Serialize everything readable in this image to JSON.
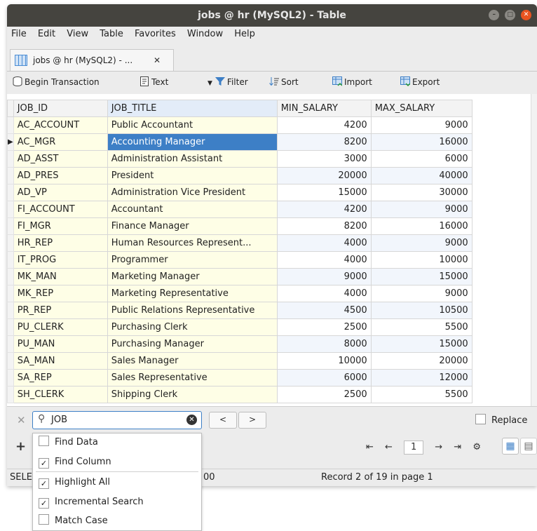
{
  "window": {
    "title": "jobs @ hr (MySQL2) - Table"
  },
  "menu": [
    "File",
    "Edit",
    "View",
    "Table",
    "Favorites",
    "Window",
    "Help"
  ],
  "doc_tab": {
    "label": "jobs @ hr (MySQL2) - ...",
    "close": "✕"
  },
  "toolbar": {
    "begin_transaction": "Begin Transaction",
    "text": "Text",
    "filter": "Filter",
    "sort": "Sort",
    "import": "Import",
    "export": "Export"
  },
  "table": {
    "columns": [
      "JOB_ID",
      "JOB_TITLE",
      "MIN_SALARY",
      "MAX_SALARY"
    ],
    "rows": [
      [
        "AC_ACCOUNT",
        "Public Accountant",
        "4200",
        "9000"
      ],
      [
        "AC_MGR",
        "Accounting Manager",
        "8200",
        "16000"
      ],
      [
        "AD_ASST",
        "Administration Assistant",
        "3000",
        "6000"
      ],
      [
        "AD_PRES",
        "President",
        "20000",
        "40000"
      ],
      [
        "AD_VP",
        "Administration Vice President",
        "15000",
        "30000"
      ],
      [
        "FI_ACCOUNT",
        "Accountant",
        "4200",
        "9000"
      ],
      [
        "FI_MGR",
        "Finance Manager",
        "8200",
        "16000"
      ],
      [
        "HR_REP",
        "Human Resources Represent...",
        "4000",
        "9000"
      ],
      [
        "IT_PROG",
        "Programmer",
        "4000",
        "10000"
      ],
      [
        "MK_MAN",
        "Marketing Manager",
        "9000",
        "15000"
      ],
      [
        "MK_REP",
        "Marketing Representative",
        "4000",
        "9000"
      ],
      [
        "PR_REP",
        "Public Relations Representative",
        "4500",
        "10500"
      ],
      [
        "PU_CLERK",
        "Purchasing Clerk",
        "2500",
        "5500"
      ],
      [
        "PU_MAN",
        "Purchasing Manager",
        "8000",
        "15000"
      ],
      [
        "SA_MAN",
        "Sales Manager",
        "10000",
        "20000"
      ],
      [
        "SA_REP",
        "Sales Representative",
        "6000",
        "12000"
      ],
      [
        "SH_CLERK",
        "Shipping Clerk",
        "2500",
        "5500"
      ]
    ],
    "selected_row_index": 1,
    "row_indicator": "▶"
  },
  "find": {
    "value": "JOB",
    "prev": "<",
    "next": ">",
    "replace_label": "Replace"
  },
  "find_options": [
    {
      "label": "Find Data",
      "checked": false
    },
    {
      "label": "Find Column",
      "checked": true
    },
    {
      "label": "Highlight All",
      "checked": true
    },
    {
      "label": "Incremental Search",
      "checked": true
    },
    {
      "label": "Match Case",
      "checked": false
    }
  ],
  "pager": {
    "page": "1"
  },
  "status": {
    "left_prefix": "SELE",
    "left_suffix": "00",
    "record": "Record 2 of 19 in page 1"
  },
  "colors": {
    "title_bar": "#45443f",
    "key_column_bg": "#fefee6",
    "selection": "#3d7fc6",
    "close_button": "#e95420"
  }
}
